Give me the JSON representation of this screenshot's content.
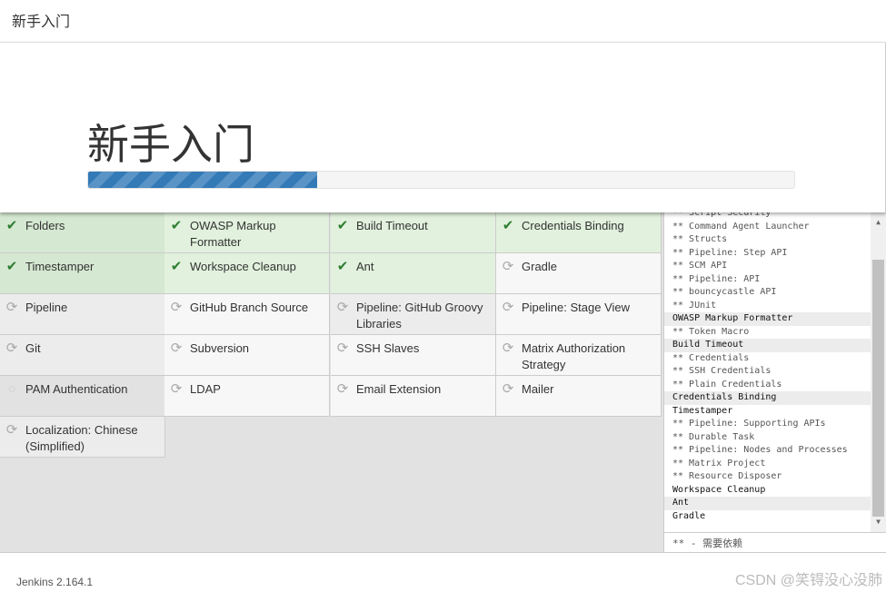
{
  "header": {
    "title": "新手入门"
  },
  "hero": {
    "title": "新手入门",
    "progress_percent": 32.4
  },
  "plugins": [
    {
      "name": "Folders",
      "status": "success"
    },
    {
      "name": "OWASP Markup Formatter",
      "status": "success"
    },
    {
      "name": "Build Timeout",
      "status": "success"
    },
    {
      "name": "Credentials Binding",
      "status": "success"
    },
    {
      "name": "Timestamper",
      "status": "success"
    },
    {
      "name": "Workspace Cleanup",
      "status": "success"
    },
    {
      "name": "Ant",
      "status": "success"
    },
    {
      "name": "Gradle",
      "status": "pending"
    },
    {
      "name": "Pipeline",
      "status": "installing"
    },
    {
      "name": "GitHub Branch Source",
      "status": "pending"
    },
    {
      "name": "Pipeline: GitHub Groovy Libraries",
      "status": "installing"
    },
    {
      "name": "Pipeline: Stage View",
      "status": "pending"
    },
    {
      "name": "Git",
      "status": "pending"
    },
    {
      "name": "Subversion",
      "status": "pending"
    },
    {
      "name": "SSH Slaves",
      "status": "pending"
    },
    {
      "name": "Matrix Authorization Strategy",
      "status": "pending"
    },
    {
      "name": "PAM Authentication",
      "status": "none"
    },
    {
      "name": "LDAP",
      "status": "pending"
    },
    {
      "name": "Email Extension",
      "status": "pending"
    },
    {
      "name": "Mailer",
      "status": "pending"
    },
    {
      "name": "Localization: Chinese (Simplified)",
      "status": "pending"
    }
  ],
  "log": [
    {
      "text": "** Script Security",
      "type": "dep"
    },
    {
      "text": "** Command Agent Launcher",
      "type": "dep"
    },
    {
      "text": "** Structs",
      "type": "dep"
    },
    {
      "text": "** Pipeline: Step API",
      "type": "dep"
    },
    {
      "text": "** SCM API",
      "type": "dep"
    },
    {
      "text": "** Pipeline: API",
      "type": "dep"
    },
    {
      "text": "** bouncycastle API",
      "type": "dep"
    },
    {
      "text": "** JUnit",
      "type": "dep"
    },
    {
      "text": "OWASP Markup Formatter",
      "type": "main-hl"
    },
    {
      "text": "** Token Macro",
      "type": "dep"
    },
    {
      "text": "Build Timeout",
      "type": "main-hl"
    },
    {
      "text": "** Credentials",
      "type": "dep"
    },
    {
      "text": "** SSH Credentials",
      "type": "dep"
    },
    {
      "text": "** Plain Credentials",
      "type": "dep"
    },
    {
      "text": "Credentials Binding",
      "type": "main-hl"
    },
    {
      "text": "Timestamper",
      "type": "main"
    },
    {
      "text": "** Pipeline: Supporting APIs",
      "type": "dep"
    },
    {
      "text": "** Durable Task",
      "type": "dep"
    },
    {
      "text": "** Pipeline: Nodes and Processes",
      "type": "dep"
    },
    {
      "text": "** Matrix Project",
      "type": "dep"
    },
    {
      "text": "** Resource Disposer",
      "type": "dep"
    },
    {
      "text": "Workspace Cleanup",
      "type": "main"
    },
    {
      "text": "Ant",
      "type": "main-hl"
    },
    {
      "text": "Gradle",
      "type": "main"
    }
  ],
  "legend": "** - 需要依赖",
  "footer": {
    "version": "Jenkins 2.164.1",
    "watermark": "CSDN @笑锝没心没肺"
  }
}
